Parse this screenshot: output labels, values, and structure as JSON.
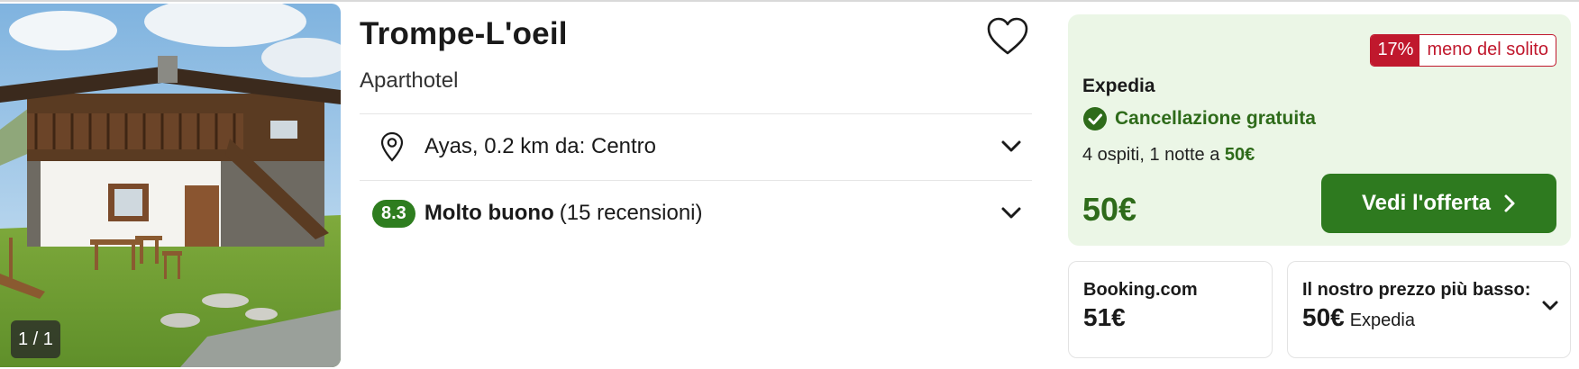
{
  "photo": {
    "counter": "1 / 1"
  },
  "listing": {
    "title": "Trompe-L'oeil",
    "type": "Aparthotel",
    "location": "Ayas, 0.2 km da: Centro",
    "rating": {
      "score": "8.3",
      "label": "Molto buono",
      "reviews": "(15 recensioni)"
    }
  },
  "offer": {
    "deal_percent": "17%",
    "deal_text": "meno del solito",
    "provider": "Expedia",
    "cancellation": "Cancellazione gratuita",
    "guests_prefix": "4 ospiti, 1 notte a ",
    "guests_price": "50€",
    "price": "50€",
    "cta_label": "Vedi l'offerta"
  },
  "alternatives": [
    {
      "label": "Booking.com",
      "price": "51€"
    },
    {
      "label": "Il nostro prezzo più basso:",
      "price": "50€",
      "provider": "Expedia"
    }
  ],
  "icons": {
    "favorite": "heart-outline-icon",
    "location": "map-pin-icon",
    "expand": "chevron-down-icon",
    "check": "check-circle-icon",
    "cta_arrow": "chevron-right-icon"
  },
  "colors": {
    "accent_green": "#2e7a1f",
    "offer_bg": "#ebf6e6",
    "deal_red": "#c0182d"
  }
}
